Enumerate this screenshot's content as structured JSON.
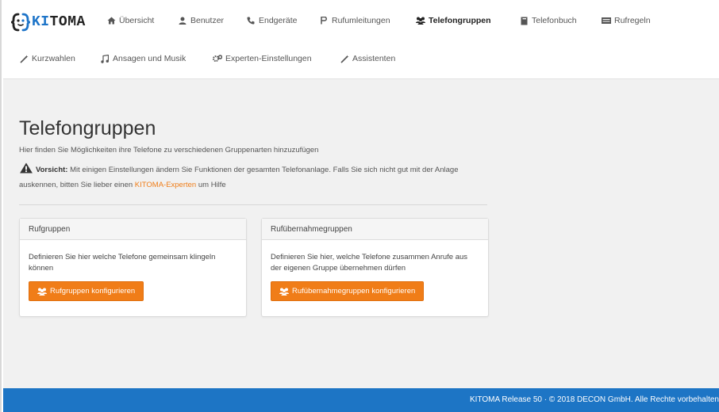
{
  "brand": {
    "name_prefix": "",
    "name_highlight": "KI",
    "name_rest": "TOMA"
  },
  "nav": {
    "items": [
      {
        "label": "Übersicht",
        "icon": "home-icon"
      },
      {
        "label": "Benutzer",
        "icon": "user-icon"
      },
      {
        "label": "Endgeräte",
        "icon": "phone-icon"
      },
      {
        "label": "Rufumleitungen",
        "icon": "redirect-icon"
      },
      {
        "label": "Telefongruppen",
        "icon": "group-icon",
        "active": true
      },
      {
        "label": "Telefonbuch",
        "icon": "book-icon"
      },
      {
        "label": "Rufregeln",
        "icon": "rules-icon"
      },
      {
        "label": "Kurzwahlen",
        "icon": "wand-icon"
      },
      {
        "label": "Ansagen und Musik",
        "icon": "music-icon"
      },
      {
        "label": "Experten-Einstellungen",
        "icon": "cogs-icon"
      },
      {
        "label": "Assistenten",
        "icon": "wand-icon"
      }
    ]
  },
  "page": {
    "title": "Telefongruppen",
    "intro": "Hier finden Sie Möglichkeiten ihre Telefone zu verschiedenen Gruppenarten hinzuzufügen",
    "warning_label": "Vorsicht:",
    "warning_text_1": "Mit einigen Einstellungen ändern Sie Funktionen der gesamten Telefonanlage. Falls Sie sich nicht gut mit der Anlage auskennen, bitten Sie lieber einen",
    "warning_link": "KITOMA-Experten",
    "warning_text_2": "um Hilfe"
  },
  "panels": [
    {
      "heading": "Rufgruppen",
      "body": "Definieren Sie hier welche Telefone gemeinsam klingeln können",
      "button": "Rufgruppen konfigurieren"
    },
    {
      "heading": "Rufübernahmegruppen",
      "body": "Definieren Sie hier, welche Telefone zusammen Anrufe aus der eigenen Gruppe übernehmen dürfen",
      "button": "Rufübernahmegruppen konfigurieren"
    }
  ],
  "footer": {
    "text": "KITOMA Release 50 · © 2018 DECON GmbH. Alle Rechte vorbehalten"
  },
  "colors": {
    "accent": "#f07d18",
    "brand_blue": "#1d75c5",
    "content_bg": "#f1f1f1"
  }
}
